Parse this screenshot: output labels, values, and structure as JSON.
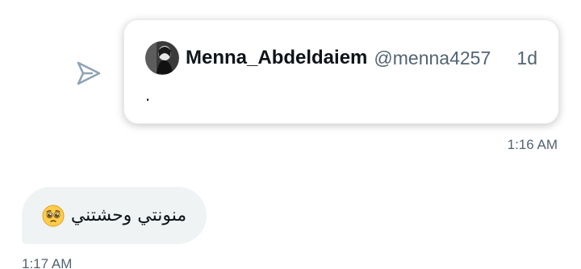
{
  "sent_message": {
    "icon": "send-arrow-icon",
    "tweet": {
      "author_name": "Menna_Abdeldaiem",
      "author_handle": "@menna4257",
      "age": "1d",
      "body": "."
    },
    "timestamp": "1:16 AM"
  },
  "received_message": {
    "text": "منونتي وحشتني",
    "emoji_icon": "pleading-face-emoji-icon",
    "timestamp": "1:17 AM"
  },
  "colors": {
    "icon": "#8fa3b5",
    "bubble": "#eff3f4",
    "muted_text": "#536471",
    "primary_text": "#0f1419"
  }
}
